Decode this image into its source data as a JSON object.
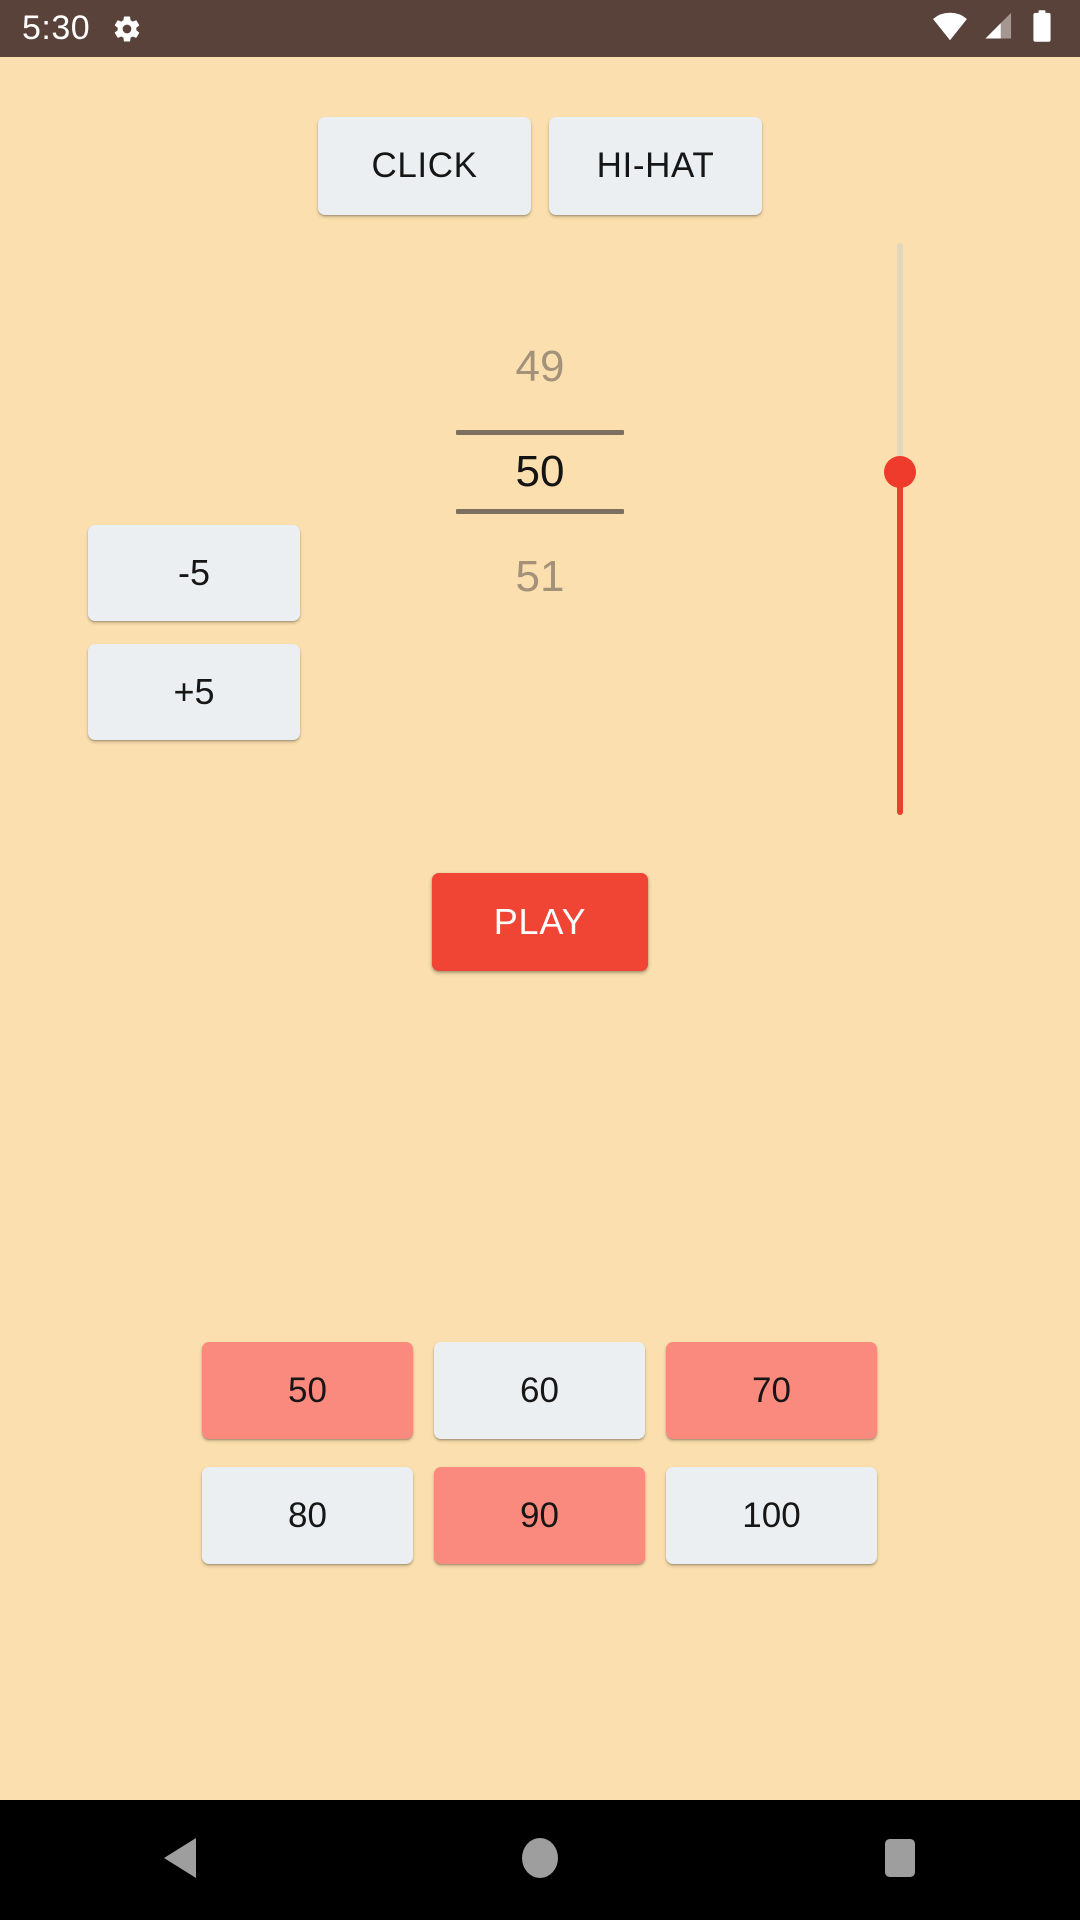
{
  "statusbar": {
    "time": "5:30",
    "icons": {
      "gear": "gear-icon",
      "wifi": "wifi-icon",
      "signal": "cellular-signal-icon",
      "battery": "battery-icon"
    }
  },
  "theme": {
    "background": "#FBDFAE",
    "statusbar_bg": "#59423A",
    "accent_red": "#F04434",
    "slider_red": "#EE3B2B",
    "slider_track": "#E2D6BE",
    "button_gray": "#ECEFF1",
    "preset_active": "#F98A7D",
    "picker_dim_text": "#A3917A",
    "picker_line": "#7E705F",
    "navbar_bg": "#000000"
  },
  "sounds": {
    "buttons": [
      {
        "label": "CLICK",
        "name": "sound-button-click"
      },
      {
        "label": "HI-HAT",
        "name": "sound-button-hihat"
      }
    ]
  },
  "tempo_picker": {
    "previous": "49",
    "current": "50",
    "next": "51"
  },
  "adjust": {
    "decrement": "-5",
    "increment": "+5"
  },
  "volume_slider": {
    "orientation": "vertical",
    "thumb_position_percent": 61,
    "filled_from": "bottom"
  },
  "transport": {
    "play_label": "PLAY"
  },
  "presets": {
    "items": [
      {
        "label": "50",
        "active": true
      },
      {
        "label": "60",
        "active": false
      },
      {
        "label": "70",
        "active": true
      },
      {
        "label": "80",
        "active": false
      },
      {
        "label": "90",
        "active": true
      },
      {
        "label": "100",
        "active": false
      }
    ]
  },
  "navbar": {
    "back": "back-triangle-icon",
    "home": "home-circle-icon",
    "recents": "recents-square-icon"
  }
}
